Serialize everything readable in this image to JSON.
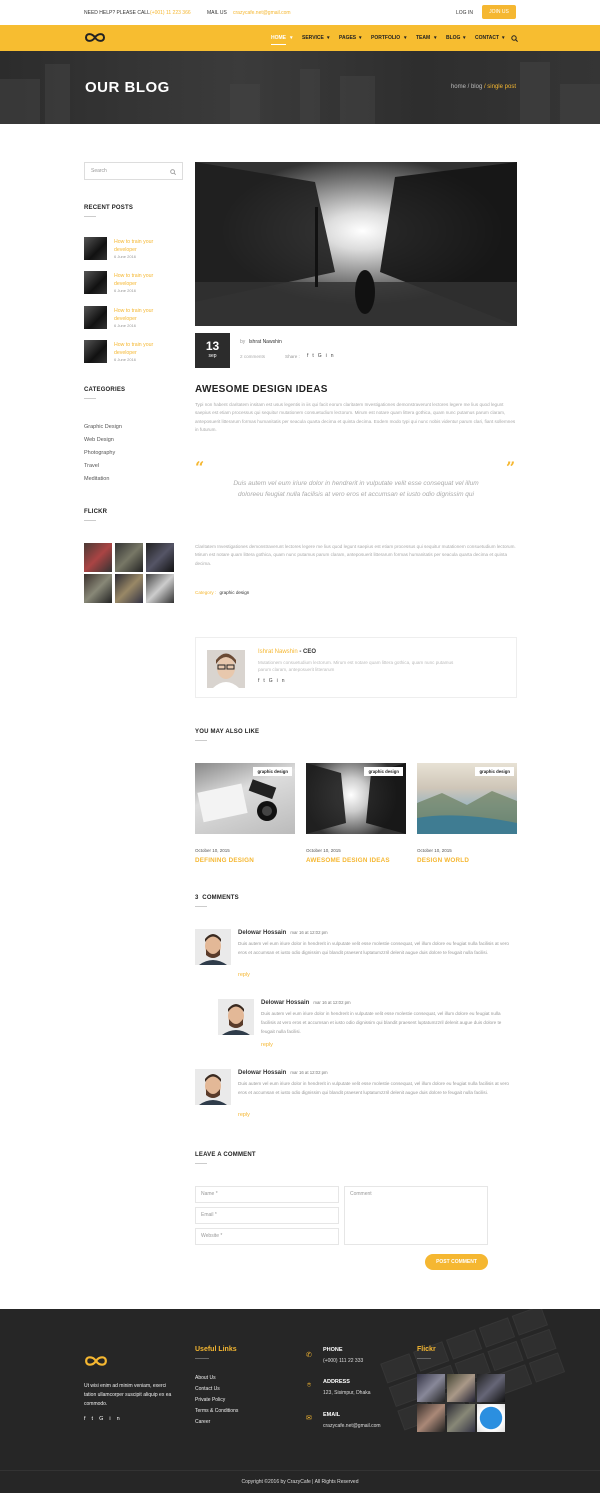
{
  "topbar": {
    "help_label": "NEED HELP? PLEASE CALL",
    "phone": "(+001) 11 223 366",
    "mail_label": "MAIL US",
    "email": "crazycafe.net@gmail.com",
    "login": "LOG IN",
    "join": "JOIN US"
  },
  "nav": {
    "items": [
      "HOME",
      "SERVICE",
      "PAGES",
      "PORTFOLIO",
      "TEAM",
      "BLOG",
      "CONTACT"
    ]
  },
  "hero": {
    "title": "OUR BLOG",
    "crumb_home": "home",
    "crumb_blog": "/ blog",
    "crumb_current": "/ single post"
  },
  "sidebar": {
    "search_placeholder": "Search",
    "recent_heading": "RECENT POSTS",
    "recent_posts": [
      {
        "title": "How to train your developer",
        "date": "6 June 2016"
      },
      {
        "title": "How to train your developer",
        "date": "6 June 2016"
      },
      {
        "title": "How to train your developer",
        "date": "6 June 2016"
      },
      {
        "title": "How to train your developer",
        "date": "6 June 2016"
      }
    ],
    "categories_heading": "CATEGORIES",
    "categories": [
      "Graphic Design",
      "Web Design",
      "Photography",
      "Travel",
      "Meditation"
    ],
    "flickr_heading": "FLICKR"
  },
  "post": {
    "day": "13",
    "month": "sep",
    "by": "by",
    "author": "Ishrat Nawshin",
    "comments": "2 comments",
    "share": "Share :",
    "title": "AWESOME DESIGN IDEAS",
    "paragraph1": "Typi non habent claritatem insitam est usus legentis in iis qui facit eorum claritatem Investigationes demonstraverunt lectores legere me lius quod legunt saepius est etiam processus qui sequitur mutationem consuetudium lectorum. Mirum est notare quam littera gothica, quam nunc putamus parum claram, anteposuerit litterarum formas humanitatis per seacula quarta decima et quinta decima. Eodem modo typi qui nunc nobis videntur parum clari, fiant sollemnes in futurum.",
    "quote": "Duis autem vel eum iriure dolor in hendrerit in vulputate velit esse consequat vel illum doloreeu feugiat nulla facilisis at vero eros et accumsan et iusto odio dignissim qui",
    "paragraph2": "Claritatem Investigationes demonstraverunt lectores legere me lius quod legunt saepius est etiam processus qui sequitur mutationem consuetudium lectorum. Mirum est notare quam littera gothica, quam nunc putamus parum claram, anteposuerit litterarum formas humanitatis per seacula quarta decima et quinta decima.",
    "category_label": "Category :",
    "category_value": "graphic design"
  },
  "author_box": {
    "name": "Ishrat Nawshin",
    "role": "- CEO",
    "bio": "Mutationem consuetudium lectorum. Mirum est notare quam littera gothica, quam nunc putamus parum claram, anteposuerit litterarum"
  },
  "related": {
    "heading": "YOU MAY ALSO LIKE",
    "items": [
      {
        "badge": "graphic design",
        "date": "October 10, 2015",
        "title": "DEFINING DESIGN"
      },
      {
        "badge": "graphic design",
        "date": "October 10, 2015",
        "title": "AWESOME DESIGN IDEAS"
      },
      {
        "badge": "graphic design",
        "date": "October 10, 2015",
        "title": "DESIGN WORLD"
      }
    ]
  },
  "comments": {
    "count": "3",
    "heading": "COMMENTS",
    "items": [
      {
        "name": "Delowar Hossain",
        "date": "mar 16 at 12:02 pm",
        "text": "Duis autem vel eum iriure dolor in hendrerit in vulputate velit esse molestie consequat, vel illum dolore eu feugiat nulla facilisis at vero eros et accumsan et iusto odio dignissim qui blandit praesent luptatumzzril delenit augue duis dolore te feugait nulla facilisi.",
        "reply": "reply"
      },
      {
        "name": "Delowar Hossain",
        "date": "mar 16 at 12:02 pm",
        "text": "Duis autem vel eum iriure dolor in hendrerit in vulputate velit esse molestie consequat, vel illum dolore eu feugiat nulla facilisis at vero eros et accumsan et iusto odio dignissim qui blandit praesent luptatumzzril delenit augue duis dolore te feugait nulla facilisi.",
        "reply": "reply"
      },
      {
        "name": "Delowar Hossain",
        "date": "mar 16 at 12:02 pm",
        "text": "Duis autem vel eum iriure dolor in hendrerit in vulputate velit esse molestie consequat, vel illum dolore eu feugiat nulla facilisis at vero eros et accumsan et iusto odio dignissim qui blandit praesent luptatumzzril delenit augue duis dolore te feugait nulla facilisi.",
        "reply": "reply"
      }
    ]
  },
  "form": {
    "heading": "LEAVE A COMMENT",
    "name": "Name *",
    "email": "Email *",
    "website": "Website *",
    "comment": "Comment",
    "submit": "POST COMMENT"
  },
  "footer": {
    "about": "Ut wisi enim ad minim veniam, exerci tation ullamcorper suscipit aliquip ex ea commodo.",
    "links_heading": "Useful Links",
    "links": [
      "About Us",
      "Contact Us",
      "Private Policy",
      "Terms & Conditions",
      "Career"
    ],
    "phone_label": "PHONE",
    "phone": "(+000) 111 22 333",
    "address_label": "ADDRESS",
    "address": "123, Sisimpur, Dhaka",
    "email_label": "EMAIL",
    "email": "crazycafe.net@gmail.com",
    "flickr_heading": "Flickr",
    "copyright": "Copyright ©2016 by CrazyCafe  |  All Rights Reserved"
  },
  "colors": {
    "accent": "#f5b731",
    "nav_bg": "#f7bd30",
    "dark": "#262626"
  }
}
